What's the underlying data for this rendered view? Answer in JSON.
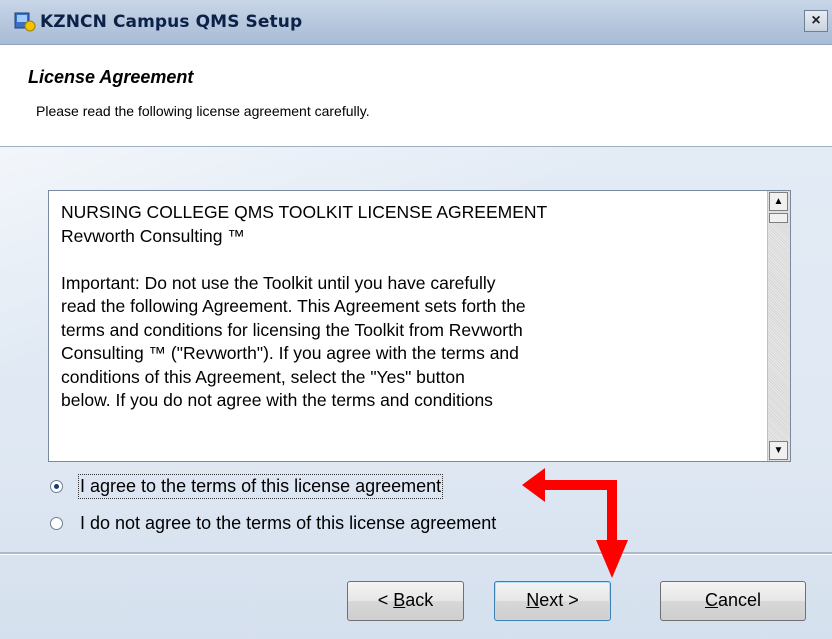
{
  "window": {
    "title": "KZNCN Campus QMS Setup",
    "close_label": "×"
  },
  "header": {
    "title": "License Agreement",
    "subtitle": "Please read the following license agreement carefully."
  },
  "license": {
    "text": "NURSING COLLEGE QMS TOOLKIT LICENSE AGREEMENT\nRevworth Consulting ™\n\nImportant:  Do not use the Toolkit until you have carefully\nread the following Agreement.  This Agreement sets forth the\nterms and conditions for licensing the Toolkit from Revworth\nConsulting ™  (\"Revworth\").  If you agree with the terms and\nconditions of this Agreement, select the \"Yes\" button\nbelow.  If you do not agree with the terms and conditions"
  },
  "options": {
    "agree_label": "I agree to the terms of this license agreement",
    "disagree_label": "I do not agree to the terms of this license agreement",
    "selected": "agree"
  },
  "buttons": {
    "back_prefix": "< ",
    "back_accel": "B",
    "back_rest": "ack",
    "next_accel": "N",
    "next_rest": "ext >",
    "cancel_accel": "C",
    "cancel_rest": "ancel"
  },
  "icons": {
    "scroll_up": "▲",
    "scroll_down": "▼"
  },
  "colors": {
    "annotation_arrow": "#ff0000"
  }
}
